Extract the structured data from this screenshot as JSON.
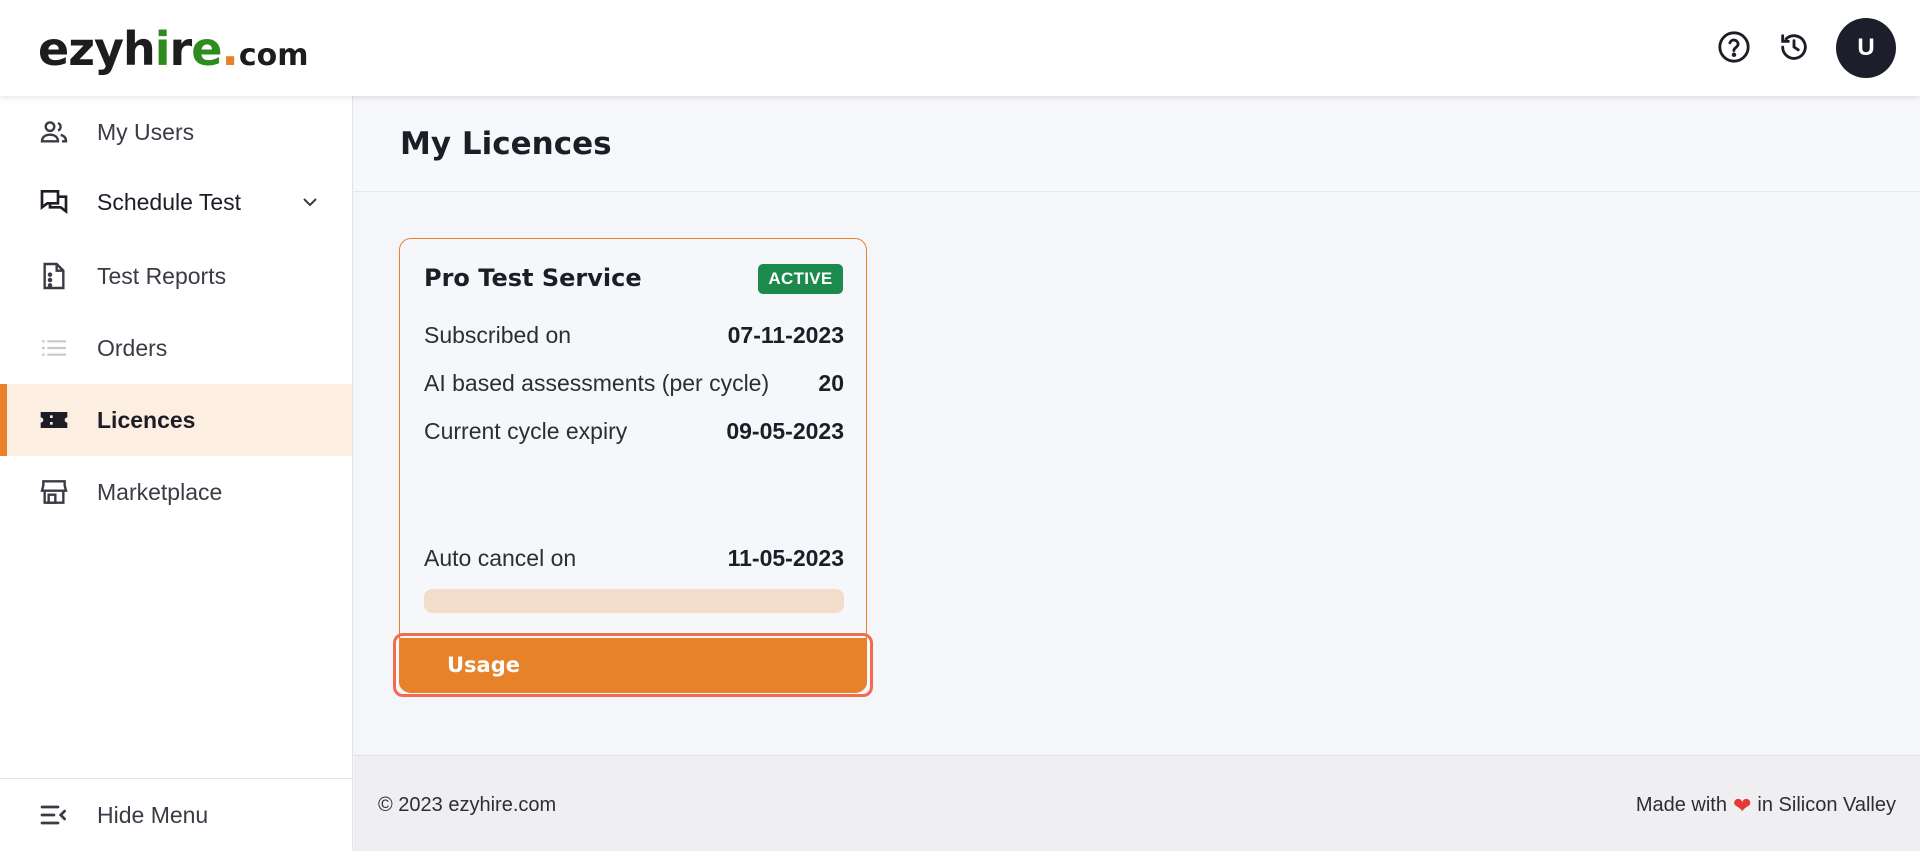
{
  "header": {
    "logo": {
      "part1": "ezyh",
      "part2": "i",
      "part3": "r",
      "part4": "e",
      "dot": ".",
      "tld": "com"
    },
    "help_icon": "help-circle-icon",
    "history_icon": "history-icon",
    "avatar_initial": "U"
  },
  "sidebar": {
    "items": [
      {
        "label": "My Users",
        "icon": "users-icon"
      },
      {
        "label": "Schedule Test",
        "icon": "chat-icon"
      },
      {
        "label": "Test Reports",
        "icon": "report-icon"
      },
      {
        "label": "Orders",
        "icon": "list-icon"
      },
      {
        "label": "Licences",
        "icon": "ticket-icon",
        "active": true
      },
      {
        "label": "Marketplace",
        "icon": "store-icon"
      }
    ],
    "hide_menu": "Hide Menu"
  },
  "main": {
    "title": "My Licences",
    "card": {
      "title": "Pro Test Service",
      "status": "ACTIVE",
      "rows": [
        {
          "label": "Subscribed on",
          "value": "07-11-2023"
        },
        {
          "label": "AI based assessments (per cycle)",
          "value": "20"
        },
        {
          "label": "Current cycle expiry",
          "value": "09-05-2023"
        },
        {
          "label": "Auto cancel on",
          "value": "11-05-2023"
        }
      ],
      "usage_progress": 0,
      "usage_button": "Usage"
    }
  },
  "footer": {
    "copyright": "© 2023 ezyhire.com",
    "made_prefix": "Made with",
    "made_suffix": "in Silicon Valley"
  },
  "colors": {
    "accent": "#e8822a",
    "active_badge": "#1b8a4c",
    "active_nav_bg": "#fdeee2"
  }
}
